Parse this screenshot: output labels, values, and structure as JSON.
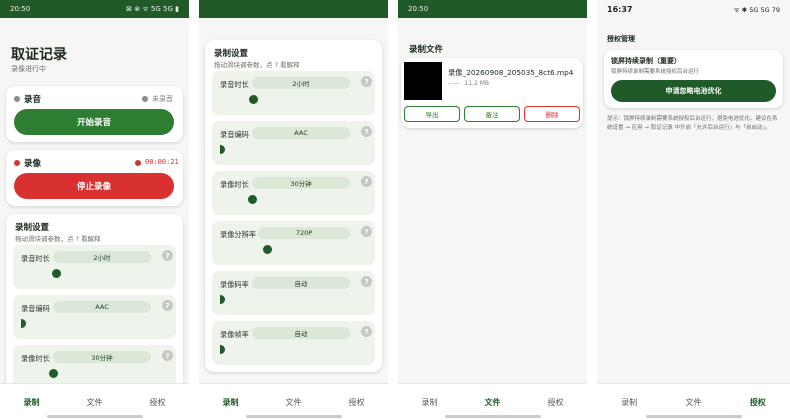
{
  "common": {
    "tabs": [
      "录制",
      "文件",
      "授权"
    ]
  },
  "screen1": {
    "status_time": "20:50",
    "status_right": "⊠ ⊗ ᯤ 5G 5G ▮",
    "title": "取证记录",
    "subtitle": "录像进行中",
    "audio": {
      "label": "录音",
      "state": "未录音",
      "button": "开始录音"
    },
    "video": {
      "label": "录像",
      "timer": "00:00:21",
      "button": "停止录像"
    },
    "settings": {
      "title": "录制设置",
      "hint": "拖动滑块调参数，点 ? 看解释",
      "rows": [
        {
          "label": "录音时长",
          "value": "2小时"
        },
        {
          "label": "录音编码",
          "value": "AAC"
        },
        {
          "label": "录像时长",
          "value": "30分钟"
        }
      ]
    }
  },
  "screen2": {
    "settings": {
      "title": "录制设置",
      "hint": "拖动滑块调参数，点 ? 看解释",
      "rows": [
        {
          "label": "录音时长",
          "value": "2小时"
        },
        {
          "label": "录音编码",
          "value": "AAC"
        },
        {
          "label": "录像时长",
          "value": "30分钟"
        },
        {
          "label": "录像分辨率",
          "value": "720P"
        },
        {
          "label": "录像码率",
          "value": "自动"
        },
        {
          "label": "录像帧率",
          "value": "自动"
        }
      ]
    }
  },
  "screen3": {
    "status_time": "20:50",
    "section_title": "录制文件",
    "file": {
      "name": "录像_20260908_205035_8ct6.mp4",
      "meta_prefix": "--:--",
      "size": "11.2 MB",
      "export": "导出",
      "backup": "备注",
      "delete": "删除"
    }
  },
  "screen4": {
    "status_time": "16:37",
    "status_right": "ᯤ ✱ 5G 5G 79",
    "section_title": "授权管理",
    "card_title": "锁屏持续录制（重要）",
    "card_desc": "锁屏持续录制需要系统授权后台运行",
    "button": "申请忽略电池优化",
    "note": "提示：锁屏持续录制需要系统授权后台运行，避免电池优化。建议在系统设置 → 应用 → 取证记录 中开启「允许后台运行」与「自启动」。"
  }
}
